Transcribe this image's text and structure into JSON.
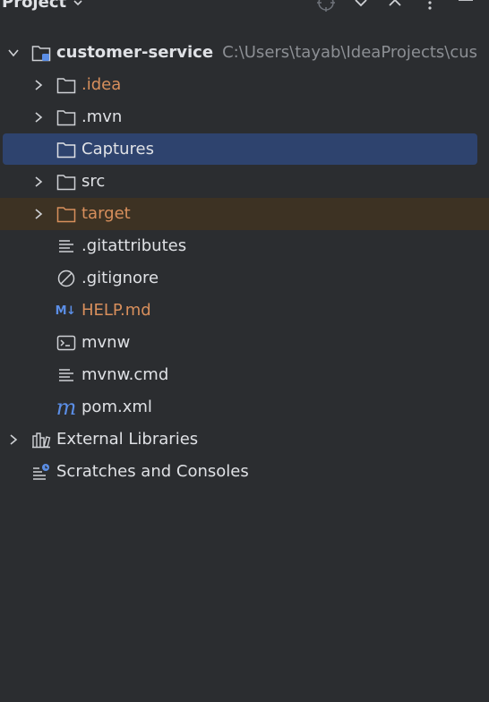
{
  "header": {
    "title": "Project",
    "toolbar_icons": [
      "locate-icon",
      "expand-all-icon",
      "collapse-all-icon",
      "more-options-icon",
      "hide-icon"
    ]
  },
  "tree": {
    "root": {
      "name": "customer-service",
      "path": "C:\\Users\\tayab\\IdeaProjects\\cus"
    },
    "items": [
      {
        "label": ".idea",
        "icon": "folder-icon",
        "color": "#d88f5c"
      },
      {
        "label": ".mvn",
        "icon": "folder-icon"
      },
      {
        "label": "Captures",
        "icon": "folder-icon"
      },
      {
        "label": "src",
        "icon": "folder-icon"
      },
      {
        "label": "target",
        "icon": "folder-icon",
        "color": "#d88f5c"
      },
      {
        "label": ".gitattributes",
        "icon": "text-file-icon"
      },
      {
        "label": ".gitignore",
        "icon": "ignore-file-icon"
      },
      {
        "label": "HELP.md",
        "icon": "markdown-icon",
        "icon_text": "M↓",
        "color": "#d88f5c"
      },
      {
        "label": "mvnw",
        "icon": "terminal-file-icon"
      },
      {
        "label": "mvnw.cmd",
        "icon": "text-file-icon"
      },
      {
        "label": "pom.xml",
        "icon": "maven-icon",
        "icon_text": "m"
      }
    ],
    "external_libraries": "External Libraries",
    "scratches": "Scratches and Consoles"
  },
  "colors": {
    "background": "#2b2d30",
    "selection": "#2e436e",
    "excluded_row": "#3d3223",
    "modified_text": "#d88f5c",
    "path_text": "#8c8f94"
  }
}
